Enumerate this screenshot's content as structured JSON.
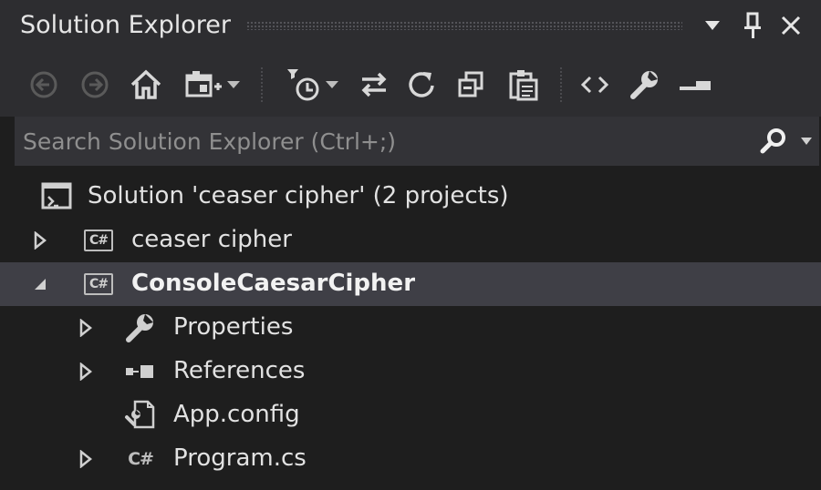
{
  "window": {
    "title": "Solution Explorer"
  },
  "toolbar": {
    "buttons": [
      {
        "name": "back",
        "icon": "arrow-left-circle-icon",
        "enabled": false
      },
      {
        "name": "forward",
        "icon": "arrow-right-circle-icon",
        "enabled": false
      },
      {
        "name": "home",
        "icon": "home-icon",
        "enabled": true
      },
      {
        "name": "switch-views",
        "icon": "switch-views-icon",
        "enabled": true
      },
      {
        "name": "pending-changes-filter",
        "icon": "clock-filter-icon",
        "enabled": true
      },
      {
        "name": "sync-with-active-document",
        "icon": "sync-arrows-icon",
        "enabled": true
      },
      {
        "name": "refresh",
        "icon": "refresh-icon",
        "enabled": true
      },
      {
        "name": "collapse-all",
        "icon": "collapse-all-icon",
        "enabled": true
      },
      {
        "name": "show-all-files",
        "icon": "show-all-files-icon",
        "enabled": true
      },
      {
        "name": "view-code",
        "icon": "code-brackets-icon",
        "enabled": true
      },
      {
        "name": "properties",
        "icon": "wrench-icon",
        "enabled": true
      },
      {
        "name": "preview-selected-items",
        "icon": "preview-icon",
        "enabled": true
      }
    ]
  },
  "search": {
    "placeholder": "Search Solution Explorer (Ctrl+;)",
    "value": ""
  },
  "tree": {
    "solution": {
      "label": "Solution 'ceaser cipher' (2 projects)",
      "icon": "solution-icon"
    },
    "project1": {
      "label": "ceaser cipher",
      "icon": "csharp-project-icon",
      "badge": "C#",
      "expanded": false
    },
    "project2": {
      "label": "ConsoleCaesarCipher",
      "icon": "csharp-project-icon",
      "badge": "C#",
      "expanded": true,
      "selected": true
    },
    "properties": {
      "label": "Properties",
      "icon": "wrench-icon",
      "expanded": false
    },
    "references": {
      "label": "References",
      "icon": "references-icon",
      "expanded": false
    },
    "appconfig": {
      "label": "App.config",
      "icon": "config-file-icon"
    },
    "program": {
      "label": "Program.cs",
      "icon": "csharp-file-icon",
      "badge": "C#",
      "expanded": false
    }
  },
  "colors": {
    "background": "#1e1e1e",
    "toolbar": "#2d2d30",
    "search_bg": "#333337",
    "selection": "#3f3f46",
    "text": "#e2e2e2",
    "icon": "#d0d0d0",
    "disabled_icon": "#5a5a5a"
  }
}
